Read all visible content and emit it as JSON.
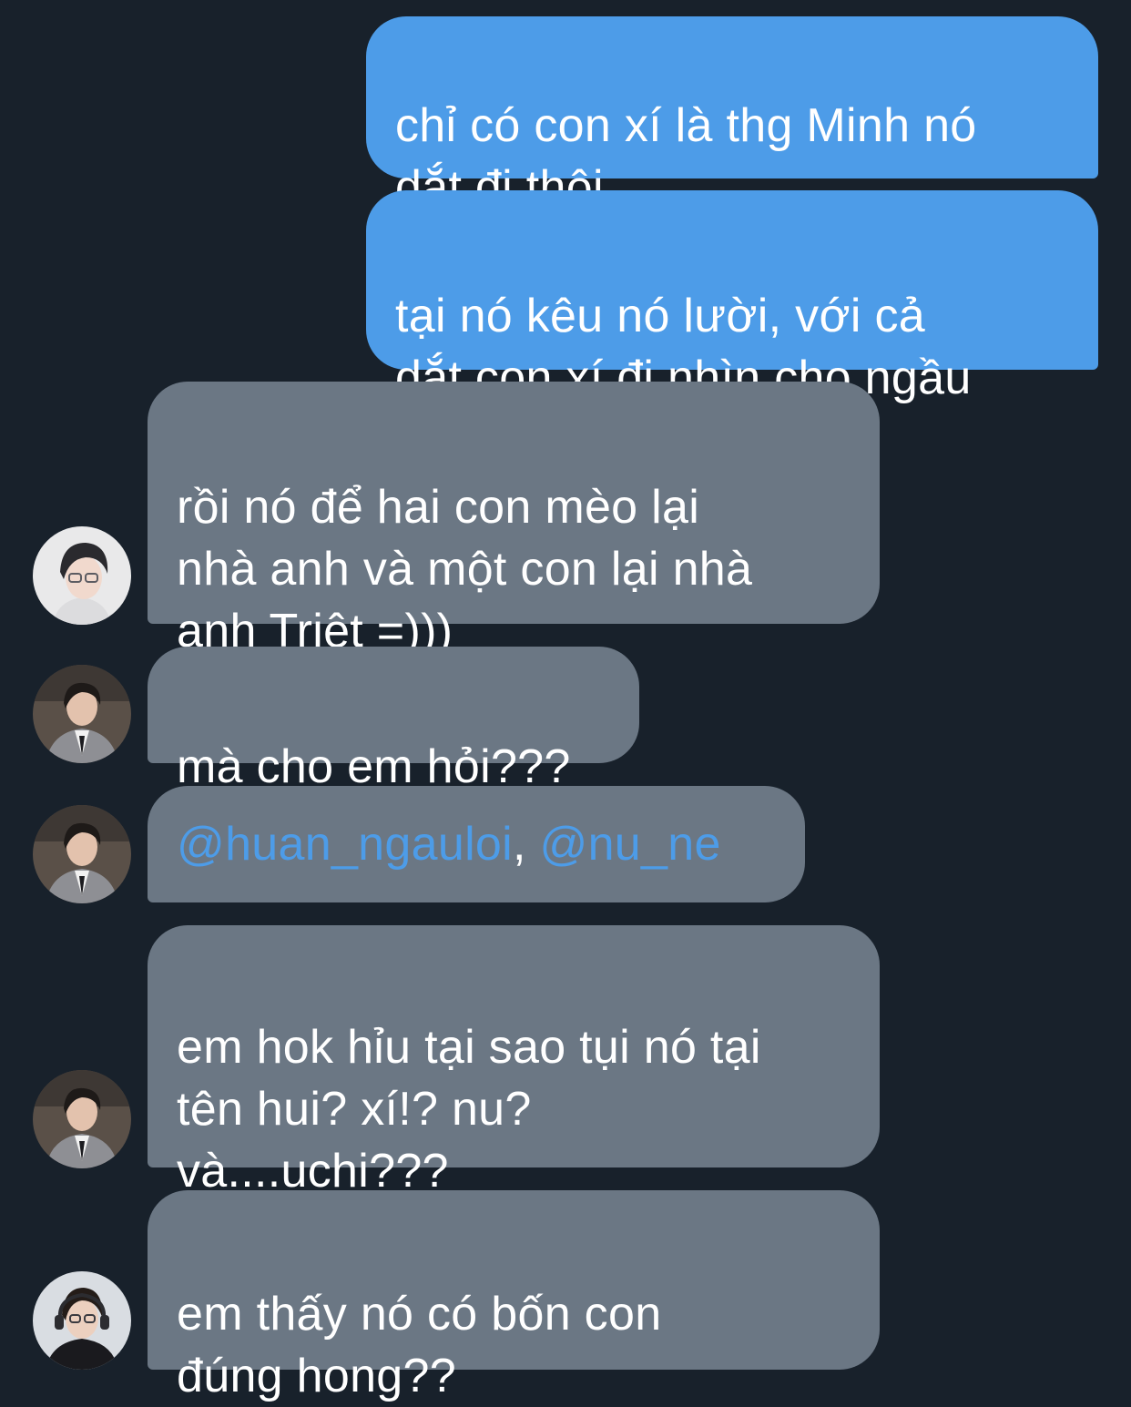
{
  "messages": [
    {
      "direction": "outgoing",
      "text": "chỉ có con xí là thg Minh nó\ndắt đi thôi"
    },
    {
      "direction": "outgoing",
      "text": "tại nó kêu nó lười, với cả\ndắt con xí đi nhìn cho ngầu"
    },
    {
      "direction": "incoming",
      "text": "rồi nó để hai con mèo lại\nnhà anh và một con lại nhà\nanh Triệt =)))"
    },
    {
      "direction": "incoming",
      "text": "mà cho em hỏi???"
    },
    {
      "direction": "incoming",
      "mentions": [
        "@huan_ngauloi",
        "@nu_ne"
      ],
      "separator": ", "
    },
    {
      "direction": "incoming",
      "text": "em hok hỉu tại sao tụi nó tại\ntên hui? xí!? nu?\nvà....uchi???"
    },
    {
      "direction": "incoming",
      "text": "em thấy nó có bốn con\nđúng hong??"
    }
  ],
  "colors": {
    "background": "#18212b",
    "outgoing_bubble": "#4d9ce8",
    "incoming_bubble": "#6b7784",
    "mention": "#4d9ce8",
    "text": "#ffffff"
  }
}
